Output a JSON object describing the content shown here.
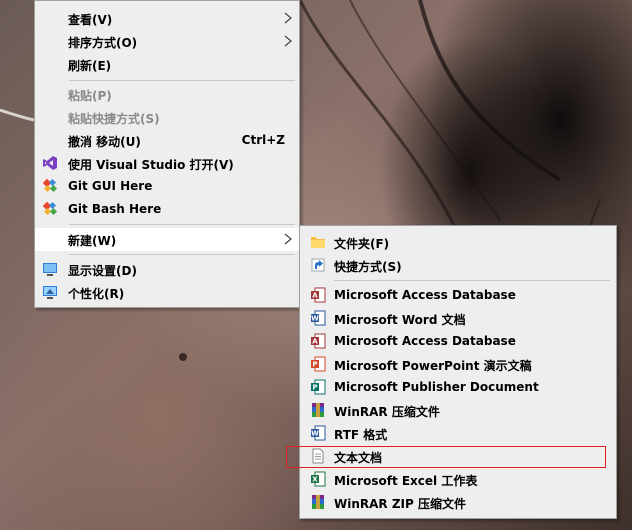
{
  "context_menu": {
    "items": [
      {
        "label": "查看(V)",
        "icon": "",
        "submenu": true
      },
      {
        "label": "排序方式(O)",
        "icon": "",
        "submenu": true
      },
      {
        "label": "刷新(E)",
        "icon": ""
      },
      {
        "label": "粘贴(P)",
        "icon": "",
        "disabled": true
      },
      {
        "label": "粘贴快捷方式(S)",
        "icon": "",
        "disabled": true
      },
      {
        "label": "撤消 移动(U)",
        "shortcut": "Ctrl+Z"
      },
      {
        "label": "使用 Visual Studio 打开(V)",
        "icon": "visual-studio-icon"
      },
      {
        "label": "Git GUI Here",
        "icon": "git-icon"
      },
      {
        "label": "Git Bash Here",
        "icon": "git-icon"
      },
      {
        "label": "新建(W)",
        "submenu": true,
        "hover": true
      },
      {
        "label": "显示设置(D)",
        "icon": "display-settings-icon"
      },
      {
        "label": "个性化(R)",
        "icon": "personalize-icon"
      }
    ]
  },
  "new_submenu": {
    "items": [
      {
        "label": "文件夹(F)",
        "icon": "folder-icon"
      },
      {
        "label": "快捷方式(S)",
        "icon": "shortcut-icon"
      },
      {
        "label": "Microsoft Access Database",
        "icon": "access-icon"
      },
      {
        "label": "Microsoft Word 文档",
        "icon": "word-icon"
      },
      {
        "label": "Microsoft Access Database",
        "icon": "access-icon"
      },
      {
        "label": "Microsoft PowerPoint 演示文稿",
        "icon": "powerpoint-icon"
      },
      {
        "label": "Microsoft Publisher Document",
        "icon": "publisher-icon"
      },
      {
        "label": "WinRAR 压缩文件",
        "icon": "winrar-icon"
      },
      {
        "label": "RTF 格式",
        "icon": "rtf-icon"
      },
      {
        "label": "文本文档",
        "icon": "text-document-icon",
        "highlighted": true
      },
      {
        "label": "Microsoft Excel 工作表",
        "icon": "excel-icon"
      },
      {
        "label": "WinRAR ZIP 压缩文件",
        "icon": "winrar-zip-icon"
      }
    ]
  },
  "colors": {
    "menu_bg": "#eeeeee",
    "hover_bg": "#ffffff",
    "highlight_border": "#e02020",
    "disabled_text": "#8a8a8a"
  }
}
